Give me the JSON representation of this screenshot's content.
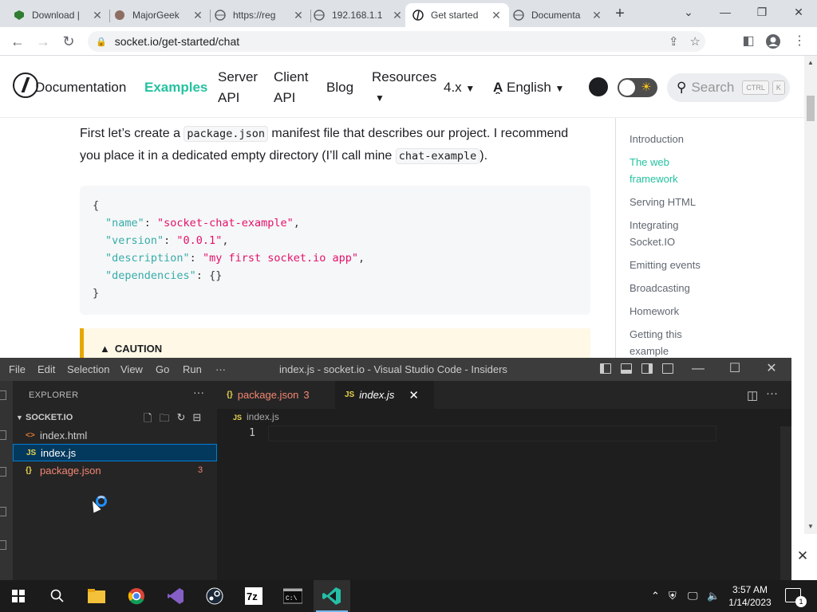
{
  "browser": {
    "tabs": [
      {
        "title": "Download |",
        "icon": "shield-icon"
      },
      {
        "title": "MajorGeek",
        "icon": "majorgeeks-icon"
      },
      {
        "title": "https://reg",
        "icon": "globe-icon"
      },
      {
        "title": "192.168.1.1",
        "icon": "globe-icon"
      },
      {
        "title": "Get started",
        "icon": "socketio-icon",
        "active": true
      },
      {
        "title": "Documenta",
        "icon": "globe-icon"
      }
    ],
    "close_glyph": "✕",
    "new_tab_glyph": "+",
    "url": "socket.io/get-started/chat"
  },
  "site": {
    "nav": {
      "documentation": "Documentation",
      "examples": "Examples",
      "server_api": "Server API",
      "client_api": "Client API",
      "blog": "Blog",
      "resources": "Resources",
      "version": "4.x",
      "language": "English",
      "search_placeholder": "Search",
      "kbd_ctrl": "CTRL",
      "kbd_k": "K"
    },
    "para": {
      "p1": "First let’s create a ",
      "c1": "package.json",
      "p2": " manifest file that describes our project. I recommend you place it in a dedicated empty directory (I’ll call mine ",
      "c2": "chat-example",
      "p3": ")."
    },
    "code": {
      "open": "{",
      "close": "}",
      "lines": [
        {
          "key": "\"name\"",
          "val": "\"socket-chat-example\"",
          "tail": ","
        },
        {
          "key": "\"version\"",
          "val": "\"0.0.1\"",
          "tail": ","
        },
        {
          "key": "\"description\"",
          "val": "\"my first socket.io app\"",
          "tail": ","
        },
        {
          "key": "\"dependencies\"",
          "val": "{}",
          "tail": ""
        }
      ]
    },
    "caution": "CAUTION",
    "toc": [
      {
        "label": "Introduction"
      },
      {
        "label": "The web framework",
        "active": true
      },
      {
        "label": "Serving HTML"
      },
      {
        "label": "Integrating Socket.IO"
      },
      {
        "label": "Emitting events"
      },
      {
        "label": "Broadcasting"
      },
      {
        "label": "Homework"
      },
      {
        "label": "Getting this example"
      }
    ]
  },
  "vscode": {
    "menu": [
      "File",
      "Edit",
      "Selection",
      "View",
      "Go",
      "Run",
      "···"
    ],
    "title": "index.js - socket.io - Visual Studio Code - Insiders",
    "explorer_header": "EXPLORER",
    "explorer_more": "···",
    "folder": "SOCKET.IO",
    "files": [
      {
        "name": "index.html",
        "icon": "<>",
        "color": "#e37933"
      },
      {
        "name": "index.js",
        "icon": "JS",
        "color": "#e8d44d",
        "selected": true
      },
      {
        "name": "package.json",
        "icon": "{}",
        "color": "#e8d44d",
        "problems": "3"
      }
    ],
    "editor_tabs": [
      {
        "name": "package.json",
        "problems": "3"
      },
      {
        "name": "index.js",
        "active": true
      }
    ],
    "breadcrumb": "index.js",
    "line_number": "1"
  },
  "taskbar": {
    "time": "3:57 AM",
    "date": "1/14/2023",
    "notification_count": "1"
  },
  "colors": {
    "accent": "#25c2a0",
    "vscode_selection": "#04395e",
    "taskbar": "#1b1b1b"
  }
}
